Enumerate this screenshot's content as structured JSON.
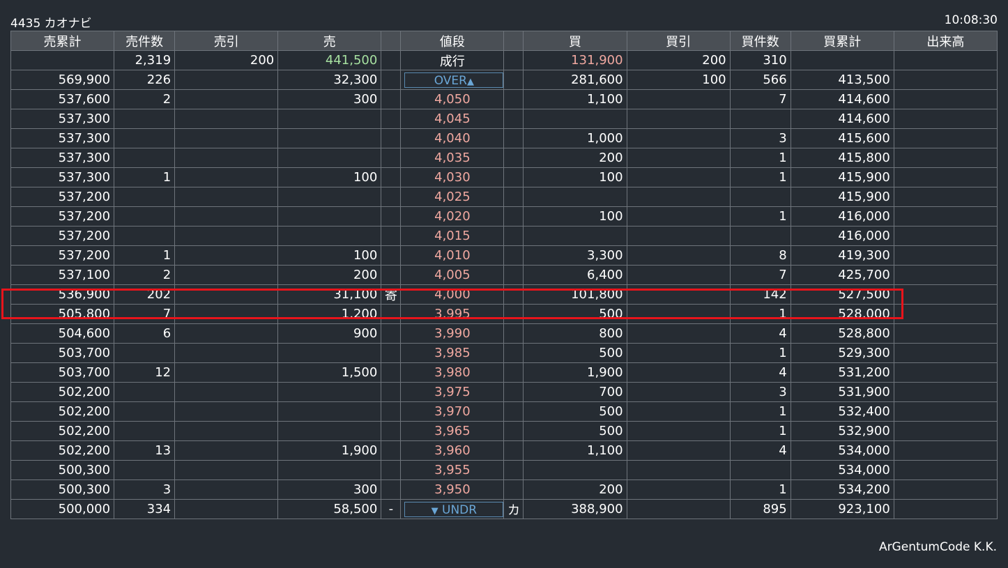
{
  "header": {
    "symbol": "4435 カオナビ",
    "time": "10:08:30"
  },
  "columns": [
    "売累計",
    "売件数",
    "売引",
    "売",
    "",
    "値段",
    "",
    "買",
    "買引",
    "買件数",
    "買累計",
    "出来高"
  ],
  "market_row": {
    "sell_cum": "",
    "sell_count": "2,319",
    "sell_discount": "200",
    "sell_qty": "441,500",
    "price": "成行",
    "buy_qty": "131,900",
    "buy_discount": "200",
    "buy_count": "310",
    "buy_cum": "",
    "volume": ""
  },
  "over_row": {
    "sell_cum": "569,900",
    "sell_count": "226",
    "sell_discount": "",
    "sell_qty": "32,300",
    "button_label": "OVER",
    "button_icon": "up-triangle",
    "buy_qty": "281,600",
    "buy_discount": "100",
    "buy_count": "566",
    "buy_cum": "413,500",
    "volume": ""
  },
  "rows": [
    {
      "sell_cum": "537,600",
      "sell_count": "2",
      "sell_qty": "300",
      "sell_flag": "",
      "price": "4,050",
      "buy_flag": "",
      "buy_qty": "1,100",
      "buy_count": "7",
      "buy_cum": "414,600"
    },
    {
      "sell_cum": "537,300",
      "sell_count": "",
      "sell_qty": "",
      "sell_flag": "",
      "price": "4,045",
      "buy_flag": "",
      "buy_qty": "",
      "buy_count": "",
      "buy_cum": "414,600"
    },
    {
      "sell_cum": "537,300",
      "sell_count": "",
      "sell_qty": "",
      "sell_flag": "",
      "price": "4,040",
      "buy_flag": "",
      "buy_qty": "1,000",
      "buy_count": "3",
      "buy_cum": "415,600"
    },
    {
      "sell_cum": "537,300",
      "sell_count": "",
      "sell_qty": "",
      "sell_flag": "",
      "price": "4,035",
      "buy_flag": "",
      "buy_qty": "200",
      "buy_count": "1",
      "buy_cum": "415,800"
    },
    {
      "sell_cum": "537,300",
      "sell_count": "1",
      "sell_qty": "100",
      "sell_flag": "",
      "price": "4,030",
      "buy_flag": "",
      "buy_qty": "100",
      "buy_count": "1",
      "buy_cum": "415,900"
    },
    {
      "sell_cum": "537,200",
      "sell_count": "",
      "sell_qty": "",
      "sell_flag": "",
      "price": "4,025",
      "buy_flag": "",
      "buy_qty": "",
      "buy_count": "",
      "buy_cum": "415,900"
    },
    {
      "sell_cum": "537,200",
      "sell_count": "",
      "sell_qty": "",
      "sell_flag": "",
      "price": "4,020",
      "buy_flag": "",
      "buy_qty": "100",
      "buy_count": "1",
      "buy_cum": "416,000"
    },
    {
      "sell_cum": "537,200",
      "sell_count": "",
      "sell_qty": "",
      "sell_flag": "",
      "price": "4,015",
      "buy_flag": "",
      "buy_qty": "",
      "buy_count": "",
      "buy_cum": "416,000"
    },
    {
      "sell_cum": "537,200",
      "sell_count": "1",
      "sell_qty": "100",
      "sell_flag": "",
      "price": "4,010",
      "buy_flag": "",
      "buy_qty": "3,300",
      "buy_count": "8",
      "buy_cum": "419,300"
    },
    {
      "sell_cum": "537,100",
      "sell_count": "2",
      "sell_qty": "200",
      "sell_flag": "",
      "price": "4,005",
      "buy_flag": "",
      "buy_qty": "6,400",
      "buy_count": "7",
      "buy_cum": "425,700"
    },
    {
      "sell_cum": "536,900",
      "sell_count": "202",
      "sell_qty": "31,100",
      "sell_flag": "寄",
      "price": "4,000",
      "buy_flag": "",
      "buy_qty": "101,800",
      "buy_count": "142",
      "buy_cum": "527,500"
    },
    {
      "sell_cum": "505,800",
      "sell_count": "7",
      "sell_qty": "1,200",
      "sell_flag": "",
      "price": "3,995",
      "buy_flag": "",
      "buy_qty": "500",
      "buy_count": "1",
      "buy_cum": "528,000"
    },
    {
      "sell_cum": "504,600",
      "sell_count": "6",
      "sell_qty": "900",
      "sell_flag": "",
      "price": "3,990",
      "buy_flag": "",
      "buy_qty": "800",
      "buy_count": "4",
      "buy_cum": "528,800"
    },
    {
      "sell_cum": "503,700",
      "sell_count": "",
      "sell_qty": "",
      "sell_flag": "",
      "price": "3,985",
      "buy_flag": "",
      "buy_qty": "500",
      "buy_count": "1",
      "buy_cum": "529,300"
    },
    {
      "sell_cum": "503,700",
      "sell_count": "12",
      "sell_qty": "1,500",
      "sell_flag": "",
      "price": "3,980",
      "buy_flag": "",
      "buy_qty": "1,900",
      "buy_count": "4",
      "buy_cum": "531,200"
    },
    {
      "sell_cum": "502,200",
      "sell_count": "",
      "sell_qty": "",
      "sell_flag": "",
      "price": "3,975",
      "buy_flag": "",
      "buy_qty": "700",
      "buy_count": "3",
      "buy_cum": "531,900"
    },
    {
      "sell_cum": "502,200",
      "sell_count": "",
      "sell_qty": "",
      "sell_flag": "",
      "price": "3,970",
      "buy_flag": "",
      "buy_qty": "500",
      "buy_count": "1",
      "buy_cum": "532,400"
    },
    {
      "sell_cum": "502,200",
      "sell_count": "",
      "sell_qty": "",
      "sell_flag": "",
      "price": "3,965",
      "buy_flag": "",
      "buy_qty": "500",
      "buy_count": "1",
      "buy_cum": "532,900"
    },
    {
      "sell_cum": "502,200",
      "sell_count": "13",
      "sell_qty": "1,900",
      "sell_flag": "",
      "price": "3,960",
      "buy_flag": "",
      "buy_qty": "1,100",
      "buy_count": "4",
      "buy_cum": "534,000"
    },
    {
      "sell_cum": "500,300",
      "sell_count": "",
      "sell_qty": "",
      "sell_flag": "",
      "price": "3,955",
      "buy_flag": "",
      "buy_qty": "",
      "buy_count": "",
      "buy_cum": "534,000"
    },
    {
      "sell_cum": "500,300",
      "sell_count": "3",
      "sell_qty": "300",
      "sell_flag": "",
      "price": "3,950",
      "buy_flag": "",
      "buy_qty": "200",
      "buy_count": "1",
      "buy_cum": "534,200"
    }
  ],
  "under_row": {
    "sell_cum": "500,000",
    "sell_count": "334",
    "sell_discount": "",
    "sell_qty": "58,500",
    "sell_flag": "-",
    "button_label": "UNDR",
    "button_icon": "down-triangle",
    "buy_flag": "カ",
    "buy_qty": "388,900",
    "buy_discount": "",
    "buy_count": "895",
    "buy_cum": "923,100",
    "volume": ""
  },
  "highlight_price": "4,000",
  "footer": {
    "credit": "ArGentumCode K.K."
  },
  "colors": {
    "background": "#262c33",
    "header": "#4a4f55",
    "price": "#f0a8a0",
    "market_sell": "#a6e0a0",
    "button": "#6aa6d6",
    "highlight": "#e8141b"
  }
}
